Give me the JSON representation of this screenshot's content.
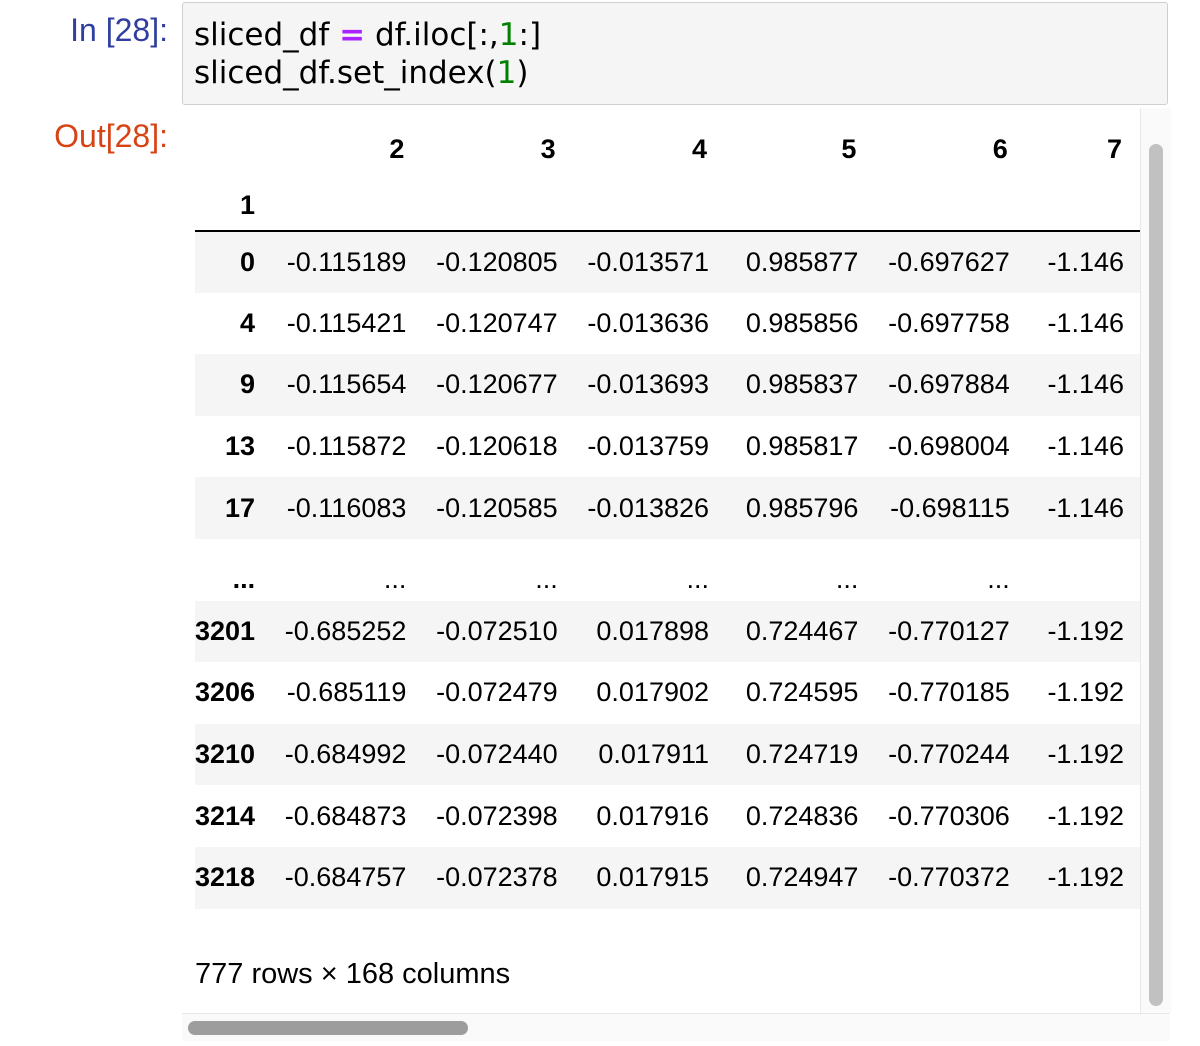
{
  "input_prompt": "In [28]:",
  "output_prompt": "Out[28]:",
  "code": {
    "line1": {
      "var": "sliced_df",
      "op": "=",
      "pre": "df.iloc[:,",
      "num": "1",
      "post": ":]"
    },
    "line2": {
      "pre": "sliced_df.set_index(",
      "num": "1",
      "post": ")"
    }
  },
  "table": {
    "columns": [
      "2",
      "3",
      "4",
      "5",
      "6",
      "7"
    ],
    "index_name": "1",
    "rows": [
      {
        "index": "0",
        "cells": [
          "-0.115189",
          "-0.120805",
          "-0.013571",
          "0.985877",
          "-0.697627",
          "-1.146"
        ]
      },
      {
        "index": "4",
        "cells": [
          "-0.115421",
          "-0.120747",
          "-0.013636",
          "0.985856",
          "-0.697758",
          "-1.146"
        ]
      },
      {
        "index": "9",
        "cells": [
          "-0.115654",
          "-0.120677",
          "-0.013693",
          "0.985837",
          "-0.697884",
          "-1.146"
        ]
      },
      {
        "index": "13",
        "cells": [
          "-0.115872",
          "-0.120618",
          "-0.013759",
          "0.985817",
          "-0.698004",
          "-1.146"
        ]
      },
      {
        "index": "17",
        "cells": [
          "-0.116083",
          "-0.120585",
          "-0.013826",
          "0.985796",
          "-0.698115",
          "-1.146"
        ]
      },
      {
        "index": "...",
        "cells": [
          "...",
          "...",
          "...",
          "...",
          "...",
          ""
        ]
      },
      {
        "index": "3201",
        "cells": [
          "-0.685252",
          "-0.072510",
          "0.017898",
          "0.724467",
          "-0.770127",
          "-1.192"
        ]
      },
      {
        "index": "3206",
        "cells": [
          "-0.685119",
          "-0.072479",
          "0.017902",
          "0.724595",
          "-0.770185",
          "-1.192"
        ]
      },
      {
        "index": "3210",
        "cells": [
          "-0.684992",
          "-0.072440",
          "0.017911",
          "0.724719",
          "-0.770244",
          "-1.192"
        ]
      },
      {
        "index": "3214",
        "cells": [
          "-0.684873",
          "-0.072398",
          "0.017916",
          "0.724836",
          "-0.770306",
          "-1.192"
        ]
      },
      {
        "index": "3218",
        "cells": [
          "-0.684757",
          "-0.072378",
          "0.017915",
          "0.724947",
          "-0.770372",
          "-1.192"
        ]
      }
    ]
  },
  "shape_text": "777 rows × 168 columns"
}
